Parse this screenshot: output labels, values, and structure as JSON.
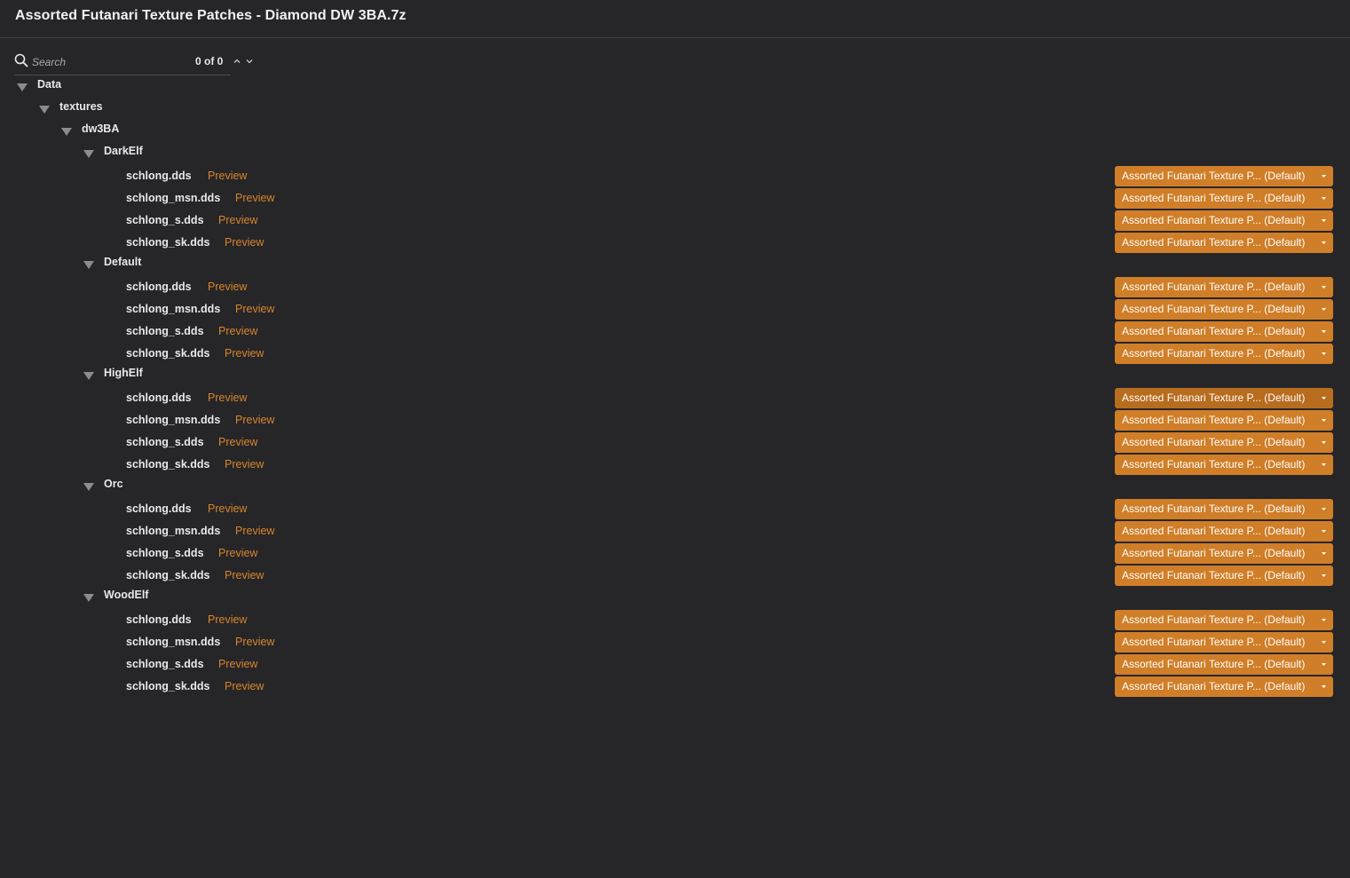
{
  "window": {
    "title": "Assorted Futanari Texture Patches - Diamond DW 3BA.7z"
  },
  "search": {
    "placeholder": "Search",
    "value": "",
    "match_count": "0 of 0"
  },
  "tree": {
    "root": "Data",
    "textures": "textures",
    "dw3ba": "dw3BA",
    "groups": [
      {
        "name": "DarkElf",
        "files": [
          {
            "name": "schlong.dds",
            "preview": "Preview",
            "source": "Assorted Futanari Texture P... (Default)"
          },
          {
            "name": "schlong_msn.dds",
            "preview": "Preview",
            "source": "Assorted Futanari Texture P... (Default)"
          },
          {
            "name": "schlong_s.dds",
            "preview": "Preview",
            "source": "Assorted Futanari Texture P... (Default)"
          },
          {
            "name": "schlong_sk.dds",
            "preview": "Preview",
            "source": "Assorted Futanari Texture P... (Default)"
          }
        ]
      },
      {
        "name": "Default",
        "files": [
          {
            "name": "schlong.dds",
            "preview": "Preview",
            "source": "Assorted Futanari Texture P... (Default)"
          },
          {
            "name": "schlong_msn.dds",
            "preview": "Preview",
            "source": "Assorted Futanari Texture P... (Default)"
          },
          {
            "name": "schlong_s.dds",
            "preview": "Preview",
            "source": "Assorted Futanari Texture P... (Default)"
          },
          {
            "name": "schlong_sk.dds",
            "preview": "Preview",
            "source": "Assorted Futanari Texture P... (Default)"
          }
        ]
      },
      {
        "name": "HighElf",
        "files": [
          {
            "name": "schlong.dds",
            "preview": "Preview",
            "source": "Assorted Futanari Texture P... (Default)"
          },
          {
            "name": "schlong_msn.dds",
            "preview": "Preview",
            "source": "Assorted Futanari Texture P... (Default)"
          },
          {
            "name": "schlong_s.dds",
            "preview": "Preview",
            "source": "Assorted Futanari Texture P... (Default)"
          },
          {
            "name": "schlong_sk.dds",
            "preview": "Preview",
            "source": "Assorted Futanari Texture P... (Default)"
          }
        ]
      },
      {
        "name": "Orc",
        "files": [
          {
            "name": "schlong.dds",
            "preview": "Preview",
            "source": "Assorted Futanari Texture P... (Default)"
          },
          {
            "name": "schlong_msn.dds",
            "preview": "Preview",
            "source": "Assorted Futanari Texture P... (Default)"
          },
          {
            "name": "schlong_s.dds",
            "preview": "Preview",
            "source": "Assorted Futanari Texture P... (Default)"
          },
          {
            "name": "schlong_sk.dds",
            "preview": "Preview",
            "source": "Assorted Futanari Texture P... (Default)"
          }
        ]
      },
      {
        "name": "WoodElf",
        "files": [
          {
            "name": "schlong.dds",
            "preview": "Preview",
            "source": "Assorted Futanari Texture P... (Default)"
          },
          {
            "name": "schlong_msn.dds",
            "preview": "Preview",
            "source": "Assorted Futanari Texture P... (Default)"
          },
          {
            "name": "schlong_s.dds",
            "preview": "Preview",
            "source": "Assorted Futanari Texture P... (Default)"
          },
          {
            "name": "schlong_sk.dds",
            "preview": "Preview",
            "source": "Assorted Futanari Texture P... (Default)"
          }
        ]
      }
    ]
  },
  "colors": {
    "background": "#262629",
    "accent": "#d07e28",
    "accent_hover": "#b86c1e",
    "link": "#d7852a"
  },
  "icons": {
    "search": "search-icon",
    "expanded": "triangle-down-icon",
    "next": "chevron-down-icon",
    "previous": "chevron-up-icon",
    "dropdown": "caret-down-icon"
  }
}
